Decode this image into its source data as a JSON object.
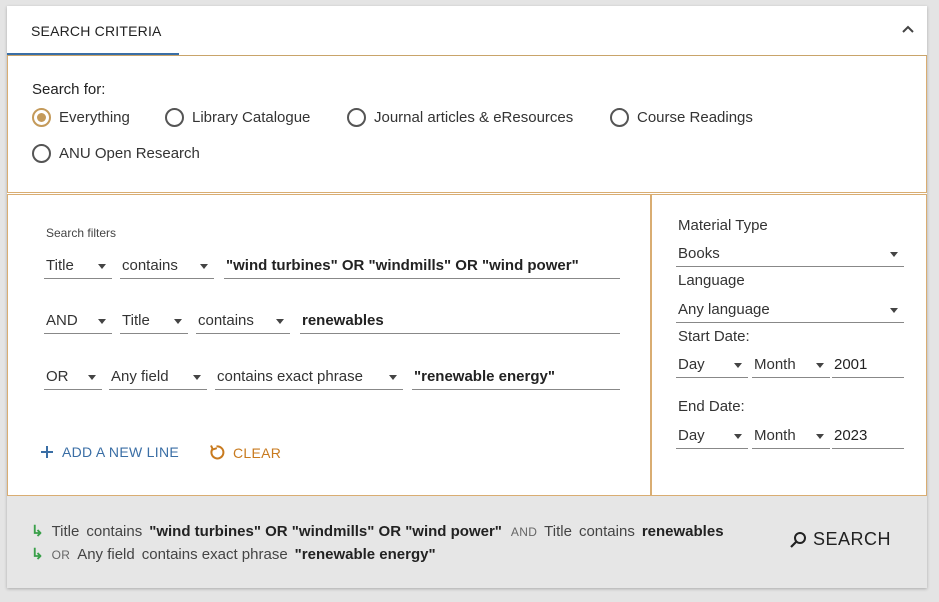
{
  "tab": {
    "label": "SEARCH CRITERIA"
  },
  "search_for": {
    "label": "Search for:",
    "options": [
      "Everything",
      "Library Catalogue",
      "Journal articles & eResources",
      "Course Readings",
      "ANU Open Research"
    ],
    "selected": "Everything"
  },
  "filters": {
    "title": "Search filters",
    "rows": [
      {
        "operator": "",
        "field": "Title",
        "match": "contains",
        "value": "\"wind turbines\" OR \"windmills\" OR \"wind power\""
      },
      {
        "operator": "AND",
        "field": "Title",
        "match": "contains",
        "value": "renewables"
      },
      {
        "operator": "OR",
        "field": "Any field",
        "match": "contains exact phrase",
        "value": "\"renewable energy\""
      }
    ],
    "add_label": "ADD A NEW LINE",
    "clear_label": "CLEAR"
  },
  "sidebar": {
    "material_type_label": "Material Type",
    "material_type_value": "Books",
    "language_label": "Language",
    "language_value": "Any language",
    "start_date_label": "Start Date:",
    "start_day": "Day",
    "start_month": "Month",
    "start_year": "2001",
    "end_date_label": "End Date:",
    "end_day": "Day",
    "end_month": "Month",
    "end_year": "2023"
  },
  "summary": {
    "line1": {
      "f1": "Title",
      "m1": "contains",
      "v1": "\"wind turbines\" OR \"windmills\" OR \"wind power\"",
      "op": "AND",
      "f2": "Title",
      "m2": "contains",
      "v2": "renewables"
    },
    "line2": {
      "op": "OR",
      "f": "Any field",
      "m": "contains exact phrase",
      "v": "\"renewable energy\""
    },
    "search_label": "SEARCH"
  },
  "colors": {
    "accent_gold": "#d9ad72",
    "link_blue": "#3a6ea5",
    "clear_orange": "#c87a1e",
    "arrow_green": "#3aa04a"
  }
}
